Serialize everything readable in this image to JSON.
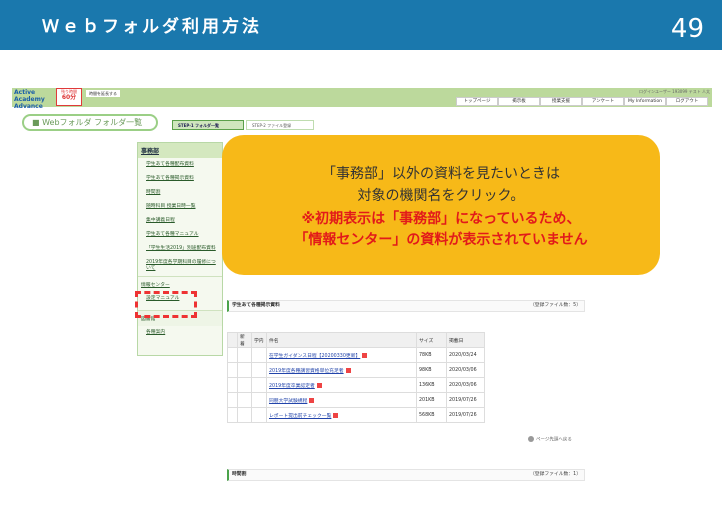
{
  "slide": {
    "title": "Ｗｅｂフォルダ利用方法",
    "page": "49"
  },
  "header": {
    "logo": "Active Academy Advance",
    "timer_label": "残り時間",
    "timer_value": "60分",
    "extend": "時間を延長する",
    "login": "ログインユーザー 193099 テスト 人太",
    "nav": [
      "トップページ",
      "掲示板",
      "授業支援",
      "アンケート",
      "My Information",
      "ログアウト"
    ]
  },
  "page_title": "Webフォルダ フォルダ一覧",
  "steps": [
    "STEP-1 フォルダ一覧",
    "STEP-2 ファイル登録"
  ],
  "sidebar": {
    "groups": [
      {
        "head": "事務部",
        "items": [
          "学生あて各種配布資料",
          "学生あて各種掲示資料",
          "時間割",
          "随時科目 授業日時一覧",
          "集中講義日程",
          "学生あて各種マニュアル",
          "「学生生活2019」別途配布資料",
          "2019年度各学期科目の履修について"
        ]
      },
      {
        "head": "情報センター",
        "items": [
          "設定マニュアル"
        ]
      },
      {
        "head": "図書館",
        "items": [
          "各種案内"
        ]
      }
    ]
  },
  "callout": {
    "line1": "「事務部」以外の資料を見たいときは",
    "line2": "対象の機関名をクリック。",
    "line3": "※初期表示は「事務部」になっているため、",
    "line4": "「情報センター」の資料が表示されていません"
  },
  "section1": {
    "title": "学生あて各種掲示資料",
    "count": "（登録ファイル数：5）",
    "columns": [
      "新着",
      "学内",
      "件名",
      "サイズ",
      "掲載日"
    ],
    "rows": [
      {
        "name": "在学生ガイダンス日程【20200330更新】",
        "size": "78KB",
        "date": "2020/03/24"
      },
      {
        "name": "2019年度各種講習資格単位充足者",
        "size": "98KB",
        "date": "2020/03/06"
      },
      {
        "name": "2019年度卒業認定者",
        "size": "136KB",
        "date": "2020/03/06"
      },
      {
        "name": "同朋大学試験規程",
        "size": "201KB",
        "date": "2019/07/26"
      },
      {
        "name": "レポート提出前チェック一覧",
        "size": "568KB",
        "date": "2019/07/26"
      }
    ]
  },
  "back_to_top": "ページ先頭へ戻る",
  "section2": {
    "title": "時間割",
    "count": "（登録ファイル数：1）"
  }
}
